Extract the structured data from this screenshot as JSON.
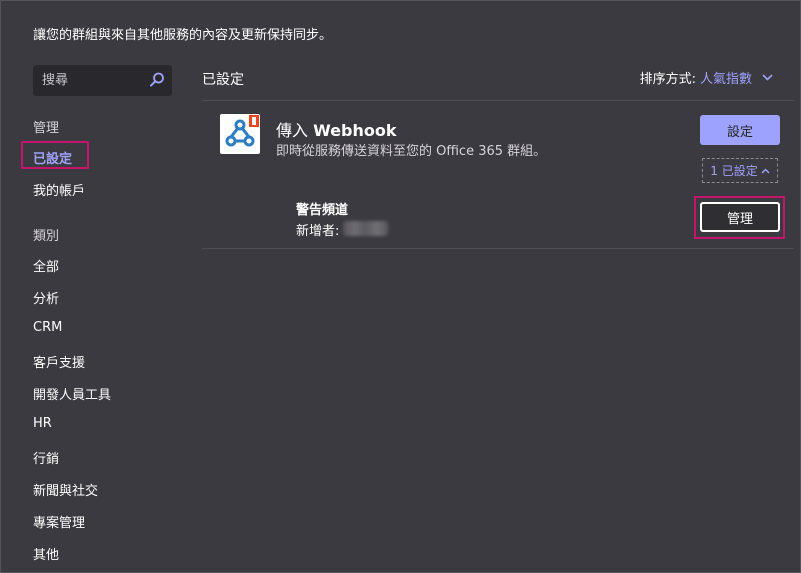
{
  "intro": "讓您的群組與來自其他服務的內容及更新保持同步。",
  "search": {
    "placeholder": "搜尋",
    "icon": "search-icon"
  },
  "sidebar": {
    "manage_header": "管理",
    "configured": "已設定",
    "my_accounts": "我的帳戶",
    "category_header": "類別",
    "categories": [
      "全部",
      "分析",
      "CRM",
      "客戶支援",
      "開發人員工具",
      "HR",
      "行銷",
      "新聞與社交",
      "專案管理",
      "其他"
    ]
  },
  "main": {
    "title": "已設定",
    "sort_label": "排序方式:",
    "sort_value": "人氣指數"
  },
  "connector": {
    "name_prefix": "傳入 ",
    "name_bold": "Webhook",
    "description": "即時從服務傳送資料至您的 Office 365 群組。",
    "configure_button": "設定",
    "configured_toggle": "1 已設定",
    "channel": "警告頻道",
    "added_by_label": "新增者:",
    "manage_button": "管理"
  },
  "colors": {
    "background": "#3b3a40",
    "accent": "#9ea2ff",
    "highlight": "#c4146b",
    "office_red": "#e8461c",
    "webhook_blue": "#2d7cc4"
  }
}
